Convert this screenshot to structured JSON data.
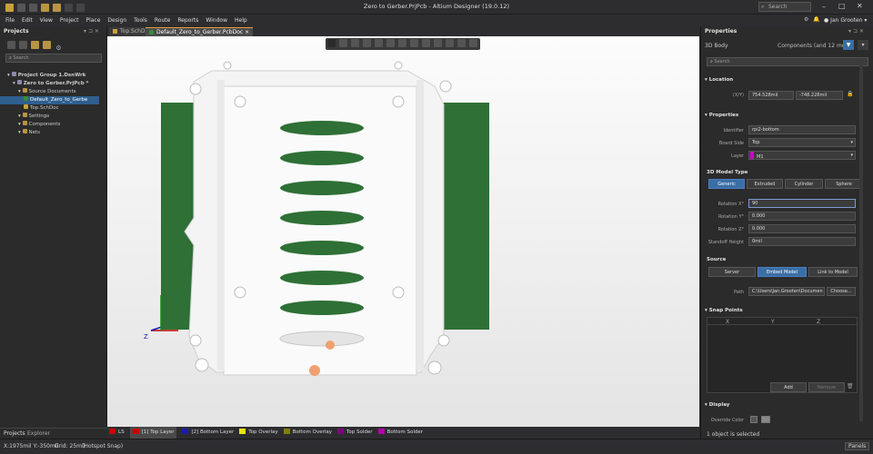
{
  "app": {
    "title": "Zero to Gerber.PrjPcb - Altium Designer (19.0.12)",
    "search_placeholder": "Search",
    "user": "Jan Grooten"
  },
  "menu": [
    "File",
    "Edit",
    "View",
    "Project",
    "Place",
    "Design",
    "Tools",
    "Route",
    "Reports",
    "Window",
    "Help"
  ],
  "projects_panel": {
    "title": "Projects",
    "search_placeholder": "Search",
    "tree": [
      {
        "label": "Project Group 1.DsnWrk",
        "level": 0,
        "bold": true
      },
      {
        "label": "Zero to Gerber.PrjPcb *",
        "level": 1,
        "bold": true
      },
      {
        "label": "Source Documents",
        "level": 2
      },
      {
        "label": "Default_Zero_to_Gerbe",
        "level": 3,
        "selected": true
      },
      {
        "label": "Top.SchDoc",
        "level": 3
      },
      {
        "label": "Settings",
        "level": 2
      },
      {
        "label": "Components",
        "level": 2
      },
      {
        "label": "Nets",
        "level": 2
      }
    ],
    "bottom_tabs": [
      "Projects",
      "Explorer"
    ]
  },
  "doc_tabs": [
    {
      "label": "Top.SchDoc",
      "active": false
    },
    {
      "label": "Default_Zero_to_Gerber.PcbDoc",
      "active": true
    }
  ],
  "layers": [
    {
      "name": "LS",
      "color": "#cc0000"
    },
    {
      "name": "[1] Top Layer",
      "color": "#cc0000"
    },
    {
      "name": "[2] Bottom Layer",
      "color": "#1a1aa8"
    },
    {
      "name": "Top Overlay",
      "color": "#e8e800"
    },
    {
      "name": "Bottom Overlay",
      "color": "#808000"
    },
    {
      "name": "Top Solder",
      "color": "#800080"
    },
    {
      "name": "Bottom Solder",
      "color": "#b000b0"
    }
  ],
  "status": {
    "coords": "X:1975mil Y:-350mil",
    "grid": "Grid: 25mil",
    "snap": "(Hotspot Snap)",
    "panels": "Panels"
  },
  "properties": {
    "title": "Properties",
    "type": "3D Body",
    "filter": "Components (and 12 more)",
    "search_placeholder": "Search",
    "location": {
      "label": "Location",
      "xy_label": "(X/Y)",
      "x": "754.528mil",
      "y": "-748.228mil"
    },
    "props": {
      "label": "Properties",
      "identifier": "rpi2-bottom",
      "board_side": "Top",
      "layer": "M1",
      "identifier_label": "Identifier",
      "board_side_label": "Board Side",
      "layer_label": "Layer"
    },
    "model_type": {
      "label": "3D Model Type",
      "options": [
        "Generic",
        "Extruded",
        "Cylinder",
        "Sphere"
      ],
      "selected": "Generic"
    },
    "rotation": [
      {
        "label": "Rotation X°",
        "value": "90"
      },
      {
        "label": "Rotation Y°",
        "value": "0.000"
      },
      {
        "label": "Rotation Z°",
        "value": "0.000"
      },
      {
        "label": "Standoff Height",
        "value": "0mil"
      }
    ],
    "source": {
      "label": "Source",
      "options": [
        "Server",
        "Embed Model",
        "Link to Model"
      ],
      "selected": "Embed Model",
      "path_label": "Path",
      "path": "C:\\Users\\Jan.Grooten\\Documen",
      "choose": "Choose..."
    },
    "snap_points": {
      "label": "Snap Points",
      "cols": [
        "X",
        "Y",
        "Z"
      ],
      "add": "Add",
      "remove": "Remove"
    },
    "display": {
      "label": "Display",
      "override_color": "Override Color"
    },
    "footer": "1 object is selected"
  },
  "colors": {
    "board_green": "#2e7035",
    "accent": "#3a6ea5",
    "layer_magenta": "#cc00cc"
  }
}
